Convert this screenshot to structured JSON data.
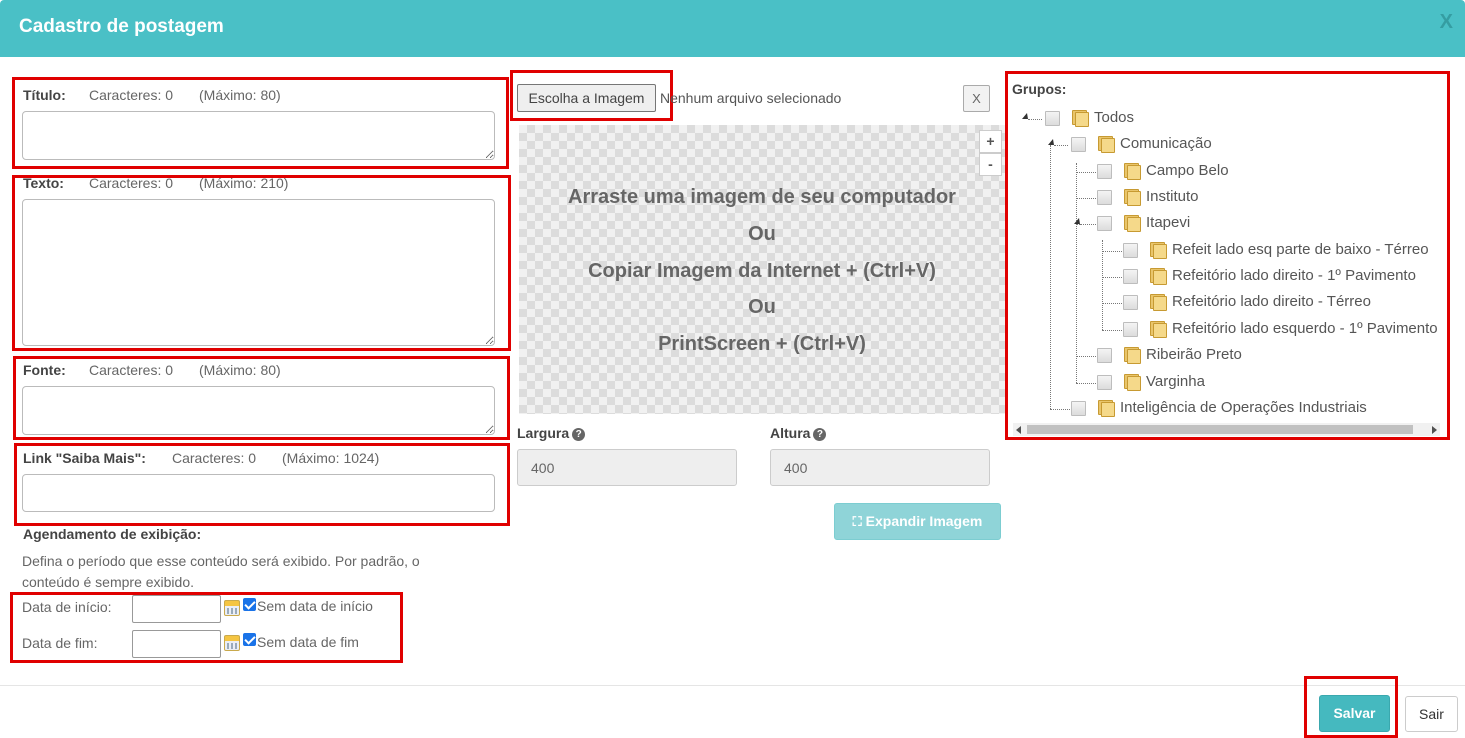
{
  "modal": {
    "title": "Cadastro de postagem",
    "close_label": "X"
  },
  "titulo": {
    "label": "Título:",
    "counter": "Caracteres: 0",
    "max": "(Máximo: 80)",
    "value": ""
  },
  "texto": {
    "label": "Texto:",
    "counter": "Caracteres: 0",
    "max": "(Máximo: 210)",
    "value": ""
  },
  "fonte": {
    "label": "Fonte:",
    "counter": "Caracteres: 0",
    "max": "(Máximo: 80)",
    "value": ""
  },
  "link": {
    "label": "Link \"Saiba Mais\":",
    "counter": "Caracteres: 0",
    "max": "(Máximo: 1024)",
    "value": ""
  },
  "agendamento": {
    "heading": "Agendamento de exibição:",
    "description": "Defina o período que esse conteúdo será exibido. Por padrão, o conteúdo é sempre exibido.",
    "inicio_label": "Data de início:",
    "inicio_value": "",
    "sem_inicio_label": "Sem data de início",
    "sem_inicio_checked": true,
    "fim_label": "Data de fim:",
    "fim_value": "",
    "sem_fim_label": "Sem data de fim",
    "sem_fim_checked": true
  },
  "imagem": {
    "choose_label": "Escolha a Imagem",
    "no_file": "Nenhum arquivo selecionado",
    "clear_label": "X",
    "drop_lines": [
      "Arraste uma imagem de seu computador",
      "Ou",
      "Copiar Imagem da Internet + (Ctrl+V)",
      "Ou",
      "PrintScreen + (Ctrl+V)"
    ],
    "zoom_in": "+",
    "zoom_out": "-",
    "largura_label": "Largura",
    "largura_value": "400",
    "altura_label": "Altura",
    "altura_value": "400",
    "help_glyph": "?",
    "expand_label": "Expandir Imagem"
  },
  "grupos": {
    "label": "Grupos:",
    "tree": [
      {
        "label": "Todos",
        "checked": false
      },
      {
        "label": "Comunicação",
        "checked": false
      },
      {
        "label": "Campo Belo",
        "checked": false
      },
      {
        "label": "Instituto",
        "checked": false
      },
      {
        "label": "Itapevi",
        "checked": false
      },
      {
        "label": "Refeit lado esq parte de baixo - Térreo",
        "checked": false
      },
      {
        "label": "Refeitório lado direito - 1º Pavimento",
        "checked": false
      },
      {
        "label": "Refeitório lado direito - Térreo",
        "checked": false
      },
      {
        "label": "Refeitório lado esquerdo - 1º Pavimento",
        "checked": false
      },
      {
        "label": "Ribeirão Preto",
        "checked": false
      },
      {
        "label": "Varginha",
        "checked": false
      },
      {
        "label": "Inteligência de Operações Industriais",
        "checked": false
      }
    ]
  },
  "footer": {
    "save_label": "Salvar",
    "exit_label": "Sair"
  }
}
